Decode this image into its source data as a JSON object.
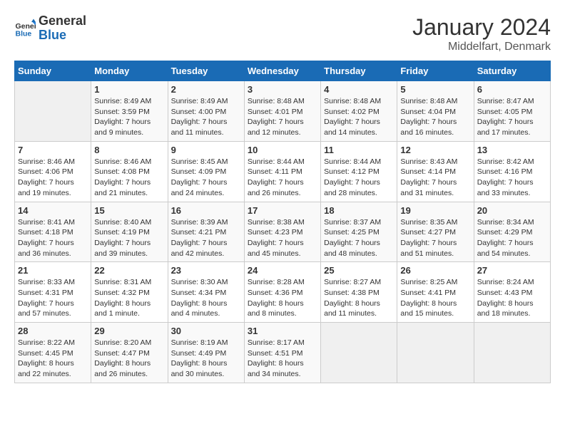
{
  "header": {
    "logo_line1": "General",
    "logo_line2": "Blue",
    "month_year": "January 2024",
    "location": "Middelfart, Denmark"
  },
  "weekdays": [
    "Sunday",
    "Monday",
    "Tuesday",
    "Wednesday",
    "Thursday",
    "Friday",
    "Saturday"
  ],
  "weeks": [
    [
      {
        "day": "",
        "info": ""
      },
      {
        "day": "1",
        "info": "Sunrise: 8:49 AM\nSunset: 3:59 PM\nDaylight: 7 hours\nand 9 minutes."
      },
      {
        "day": "2",
        "info": "Sunrise: 8:49 AM\nSunset: 4:00 PM\nDaylight: 7 hours\nand 11 minutes."
      },
      {
        "day": "3",
        "info": "Sunrise: 8:48 AM\nSunset: 4:01 PM\nDaylight: 7 hours\nand 12 minutes."
      },
      {
        "day": "4",
        "info": "Sunrise: 8:48 AM\nSunset: 4:02 PM\nDaylight: 7 hours\nand 14 minutes."
      },
      {
        "day": "5",
        "info": "Sunrise: 8:48 AM\nSunset: 4:04 PM\nDaylight: 7 hours\nand 16 minutes."
      },
      {
        "day": "6",
        "info": "Sunrise: 8:47 AM\nSunset: 4:05 PM\nDaylight: 7 hours\nand 17 minutes."
      }
    ],
    [
      {
        "day": "7",
        "info": "Sunrise: 8:46 AM\nSunset: 4:06 PM\nDaylight: 7 hours\nand 19 minutes."
      },
      {
        "day": "8",
        "info": "Sunrise: 8:46 AM\nSunset: 4:08 PM\nDaylight: 7 hours\nand 21 minutes."
      },
      {
        "day": "9",
        "info": "Sunrise: 8:45 AM\nSunset: 4:09 PM\nDaylight: 7 hours\nand 24 minutes."
      },
      {
        "day": "10",
        "info": "Sunrise: 8:44 AM\nSunset: 4:11 PM\nDaylight: 7 hours\nand 26 minutes."
      },
      {
        "day": "11",
        "info": "Sunrise: 8:44 AM\nSunset: 4:12 PM\nDaylight: 7 hours\nand 28 minutes."
      },
      {
        "day": "12",
        "info": "Sunrise: 8:43 AM\nSunset: 4:14 PM\nDaylight: 7 hours\nand 31 minutes."
      },
      {
        "day": "13",
        "info": "Sunrise: 8:42 AM\nSunset: 4:16 PM\nDaylight: 7 hours\nand 33 minutes."
      }
    ],
    [
      {
        "day": "14",
        "info": "Sunrise: 8:41 AM\nSunset: 4:18 PM\nDaylight: 7 hours\nand 36 minutes."
      },
      {
        "day": "15",
        "info": "Sunrise: 8:40 AM\nSunset: 4:19 PM\nDaylight: 7 hours\nand 39 minutes."
      },
      {
        "day": "16",
        "info": "Sunrise: 8:39 AM\nSunset: 4:21 PM\nDaylight: 7 hours\nand 42 minutes."
      },
      {
        "day": "17",
        "info": "Sunrise: 8:38 AM\nSunset: 4:23 PM\nDaylight: 7 hours\nand 45 minutes."
      },
      {
        "day": "18",
        "info": "Sunrise: 8:37 AM\nSunset: 4:25 PM\nDaylight: 7 hours\nand 48 minutes."
      },
      {
        "day": "19",
        "info": "Sunrise: 8:35 AM\nSunset: 4:27 PM\nDaylight: 7 hours\nand 51 minutes."
      },
      {
        "day": "20",
        "info": "Sunrise: 8:34 AM\nSunset: 4:29 PM\nDaylight: 7 hours\nand 54 minutes."
      }
    ],
    [
      {
        "day": "21",
        "info": "Sunrise: 8:33 AM\nSunset: 4:31 PM\nDaylight: 7 hours\nand 57 minutes."
      },
      {
        "day": "22",
        "info": "Sunrise: 8:31 AM\nSunset: 4:32 PM\nDaylight: 8 hours\nand 1 minute."
      },
      {
        "day": "23",
        "info": "Sunrise: 8:30 AM\nSunset: 4:34 PM\nDaylight: 8 hours\nand 4 minutes."
      },
      {
        "day": "24",
        "info": "Sunrise: 8:28 AM\nSunset: 4:36 PM\nDaylight: 8 hours\nand 8 minutes."
      },
      {
        "day": "25",
        "info": "Sunrise: 8:27 AM\nSunset: 4:38 PM\nDaylight: 8 hours\nand 11 minutes."
      },
      {
        "day": "26",
        "info": "Sunrise: 8:25 AM\nSunset: 4:41 PM\nDaylight: 8 hours\nand 15 minutes."
      },
      {
        "day": "27",
        "info": "Sunrise: 8:24 AM\nSunset: 4:43 PM\nDaylight: 8 hours\nand 18 minutes."
      }
    ],
    [
      {
        "day": "28",
        "info": "Sunrise: 8:22 AM\nSunset: 4:45 PM\nDaylight: 8 hours\nand 22 minutes."
      },
      {
        "day": "29",
        "info": "Sunrise: 8:20 AM\nSunset: 4:47 PM\nDaylight: 8 hours\nand 26 minutes."
      },
      {
        "day": "30",
        "info": "Sunrise: 8:19 AM\nSunset: 4:49 PM\nDaylight: 8 hours\nand 30 minutes."
      },
      {
        "day": "31",
        "info": "Sunrise: 8:17 AM\nSunset: 4:51 PM\nDaylight: 8 hours\nand 34 minutes."
      },
      {
        "day": "",
        "info": ""
      },
      {
        "day": "",
        "info": ""
      },
      {
        "day": "",
        "info": ""
      }
    ]
  ]
}
